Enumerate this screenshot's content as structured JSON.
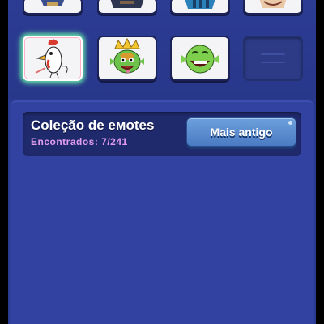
{
  "collection": {
    "title": "Coleção de eмotes",
    "found_label": "Encontrados: 7/241",
    "sort_button": "Mais antigo"
  },
  "emotes": [
    {
      "name": "knight-emote",
      "row": 1
    },
    {
      "name": "bandit-emote",
      "row": 1
    },
    {
      "name": "ice-wizard-emote",
      "row": 1
    },
    {
      "name": "princess-emote",
      "row": 1
    },
    {
      "name": "chicken-emote",
      "row": 2,
      "highlighted": true
    },
    {
      "name": "goblin-king-emote",
      "row": 2
    },
    {
      "name": "goblin-laugh-emote",
      "row": 2
    },
    {
      "name": "empty-slot",
      "row": 2
    }
  ],
  "colors": {
    "background": "#2a3a8f",
    "panel": "#3142a0",
    "header_box": "#1f2a6c",
    "title_text": "#ffffff",
    "found_text": "#e29cf0",
    "button": "#5b8dd0",
    "highlight_glow": "#63e0a6"
  }
}
